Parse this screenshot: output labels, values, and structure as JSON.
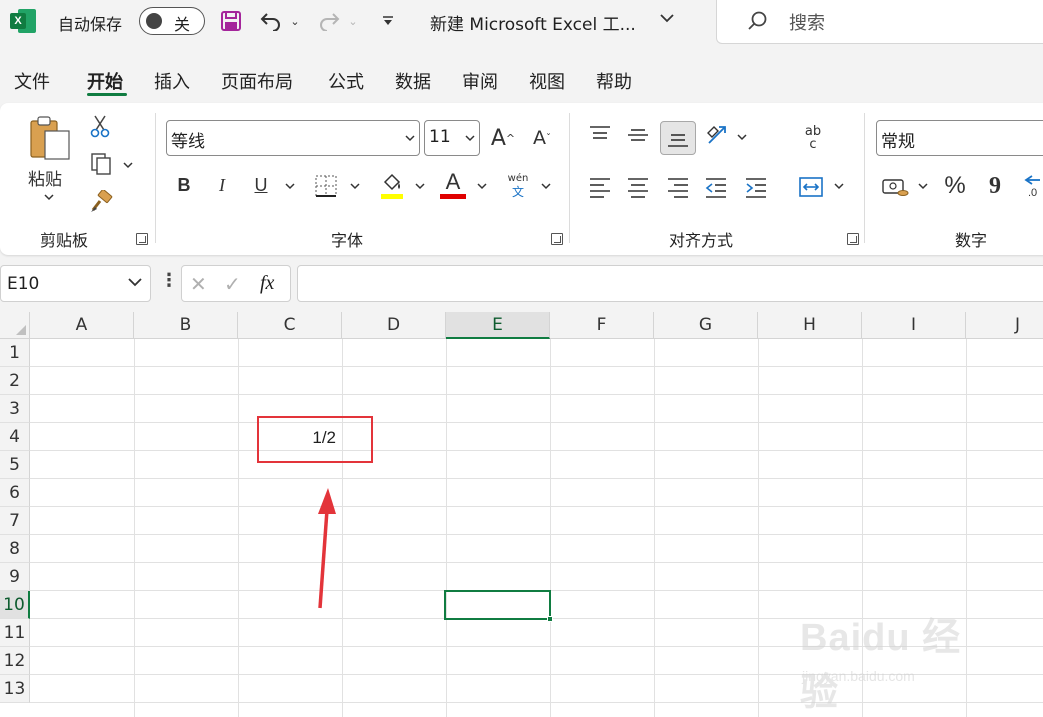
{
  "title_bar": {
    "autosave_label": "自动保存",
    "autosave_state": "关",
    "doc_title": "新建 Microsoft Excel 工...",
    "search_label": "搜索",
    "app_icon_letter": "X"
  },
  "tabs": [
    {
      "label": "文件"
    },
    {
      "label": "开始"
    },
    {
      "label": "插入"
    },
    {
      "label": "页面布局"
    },
    {
      "label": "公式"
    },
    {
      "label": "数据"
    },
    {
      "label": "审阅"
    },
    {
      "label": "视图"
    },
    {
      "label": "帮助"
    }
  ],
  "active_tab": "开始",
  "ribbon": {
    "clipboard": {
      "label": "剪贴板",
      "paste_label": "粘贴"
    },
    "font": {
      "label": "字体",
      "font_name": "等线",
      "font_size": "11",
      "bold": "B",
      "italic": "I",
      "underline": "U",
      "grow": "A",
      "shrink": "A",
      "font_color_letter": "A",
      "phonetic_top": "wén",
      "phonetic_bottom": "文",
      "fill_color": "#ffff00",
      "font_color": "#e00000"
    },
    "alignment": {
      "label": "对齐方式",
      "wrap_top": "ab",
      "wrap_bottom": "c"
    },
    "number": {
      "label": "数字",
      "format": "常规",
      "percent": "%",
      "comma": "9"
    }
  },
  "formula_bar": {
    "name_box": "E10",
    "cancel": "✕",
    "enter": "✓",
    "fx": "fx",
    "formula": ""
  },
  "sheet": {
    "columns": [
      "A",
      "B",
      "C",
      "D",
      "E",
      "F",
      "G",
      "H",
      "I",
      "J"
    ],
    "rows": [
      "1",
      "2",
      "3",
      "4",
      "5",
      "6",
      "7",
      "8",
      "9",
      "10",
      "11",
      "12",
      "13"
    ],
    "selected_column": "E",
    "selected_row": "10",
    "cells": {
      "C4": "1/2"
    }
  },
  "watermark": {
    "brand": "Bai",
    "brand_cn": "经验",
    "url": "jingyan.baidu.com"
  }
}
